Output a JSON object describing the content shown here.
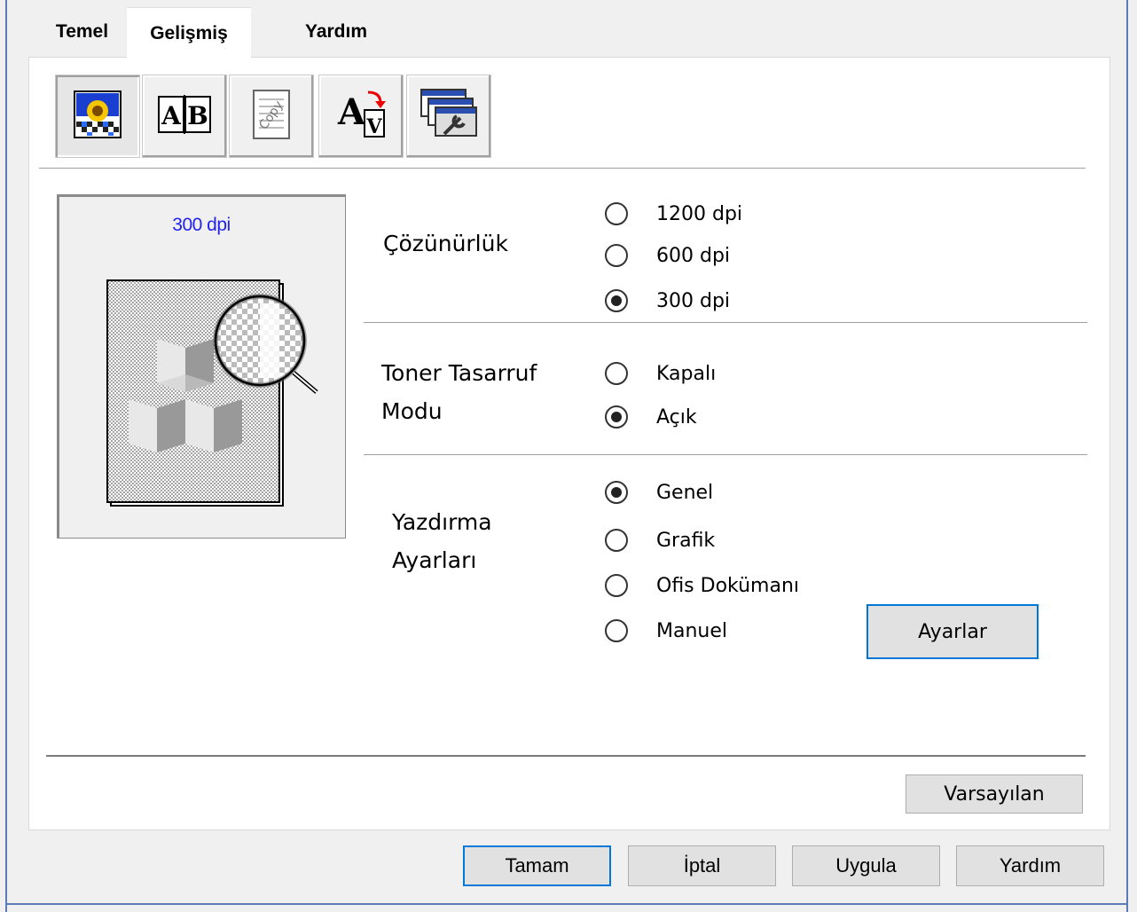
{
  "tabs": [
    {
      "label": "Temel"
    },
    {
      "label": "Gelişmiş"
    },
    {
      "label": "Yardım"
    }
  ],
  "toolbar": {
    "tools": [
      {
        "icon": "photo-quality-icon"
      },
      {
        "icon": "duplex-ab-icon"
      },
      {
        "icon": "watermark-copy-icon"
      },
      {
        "icon": "font-substitution-icon"
      },
      {
        "icon": "device-options-icon"
      }
    ]
  },
  "preview": {
    "label": "300 dpi"
  },
  "resolution": {
    "label": "Çözünürlük",
    "options": [
      "1200 dpi",
      "600 dpi",
      "300 dpi"
    ],
    "selected": "300 dpi"
  },
  "toner_save": {
    "label_line1": "Toner Tasarruf",
    "label_line2": "Modu",
    "options": [
      "Kapalı",
      "Açık"
    ],
    "selected": "Açık"
  },
  "print_settings": {
    "label_line1": "Yazdırma",
    "label_line2": "Ayarları",
    "options": [
      "Genel",
      "Grafik",
      "Ofis Dokümanı",
      "Manuel"
    ],
    "selected": "Genel",
    "settings_button": "Ayarlar"
  },
  "default_button": "Varsayılan",
  "footer": {
    "ok": "Tamam",
    "cancel": "İptal",
    "apply": "Uygula",
    "help": "Yardım"
  },
  "colors": {
    "accent": "#0078d7",
    "frame": "#5a7bb5",
    "preview_text": "#2222ee"
  }
}
